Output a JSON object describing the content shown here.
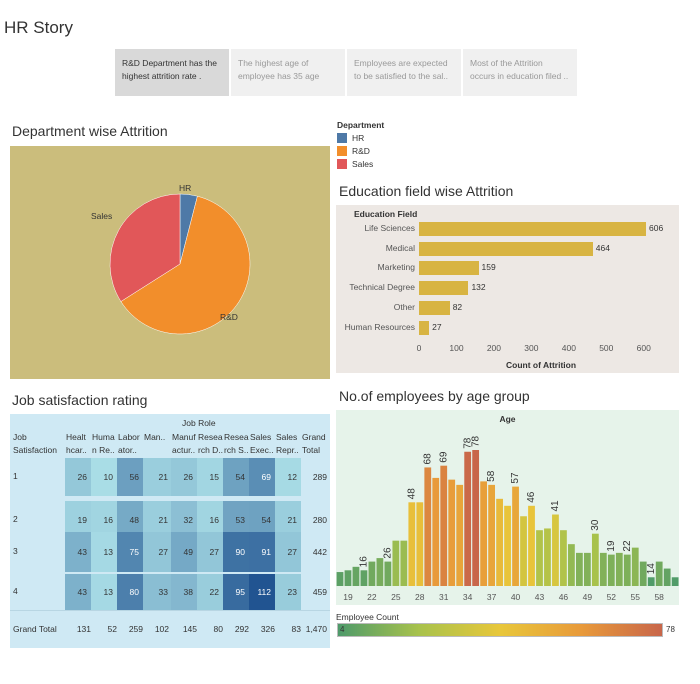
{
  "story": {
    "title": "HR Story",
    "points": [
      "R&D Department has the highest attrition rate .",
      "The highest age of employee has 35 age",
      "Employees are expected to be satisfied to the sal..",
      "Most of the Attrition occurs in education filed .."
    ],
    "active_index": 0
  },
  "sections": {
    "department": "Department wise Attrition",
    "education": "Education field wise Attrition",
    "job": "Job satisfaction rating",
    "age": "No.of employees by age group"
  },
  "legend": {
    "title": "Department",
    "items": [
      {
        "label": "HR",
        "color": "#4e79a7"
      },
      {
        "label": "R&D",
        "color": "#f28e2b"
      },
      {
        "label": "Sales",
        "color": "#e15759"
      }
    ]
  },
  "chart_data": [
    {
      "type": "pie",
      "title": "Department wise Attrition",
      "slices": [
        {
          "label": "HR",
          "value": 4,
          "color": "#4e79a7"
        },
        {
          "label": "R&D",
          "value": 62,
          "color": "#f28e2b"
        },
        {
          "label": "Sales",
          "value": 34,
          "color": "#e15759"
        }
      ]
    },
    {
      "type": "bar",
      "orientation": "horizontal",
      "title": "Education field wise Attrition",
      "category_title": "Education Field",
      "categories": [
        "Life Sciences",
        "Medical",
        "Marketing",
        "Technical Degree",
        "Other",
        "Human Resources"
      ],
      "values": [
        606,
        464,
        159,
        132,
        82,
        27
      ],
      "xlabel": "Count of Attrition",
      "xticks": [
        0,
        100,
        200,
        300,
        400,
        500,
        600
      ],
      "xlim": [
        0,
        700
      ],
      "color": "#d8b442"
    },
    {
      "type": "table",
      "title": "Job satisfaction rating",
      "column_group": "Job Role",
      "row_header": "Job\nSatisfaction",
      "columns": [
        "Healt\nhcar..",
        "Huma\nn Re..",
        "Labor\nator..",
        "Man..",
        "Manuf\nactur..",
        "Resea\nrch D..",
        "Resea\nrch S..",
        "Sales\nExec..",
        "Sales\nRepr..",
        "Grand\nTotal"
      ],
      "rows": [
        {
          "label": "1",
          "values": [
            26,
            10,
            56,
            21,
            26,
            15,
            54,
            69,
            12
          ],
          "total": "289"
        },
        {
          "label": "2",
          "values": [
            19,
            16,
            48,
            21,
            32,
            16,
            53,
            54,
            21
          ],
          "total": "280"
        },
        {
          "label": "3",
          "values": [
            43,
            13,
            75,
            27,
            49,
            27,
            90,
            91,
            27
          ],
          "total": "442"
        },
        {
          "label": "4",
          "values": [
            43,
            13,
            80,
            33,
            38,
            22,
            95,
            112,
            23
          ],
          "total": "459"
        }
      ],
      "grand_total": {
        "label": "Grand Total",
        "values": [
          "131",
          "52",
          "259",
          "102",
          "145",
          "80",
          "292",
          "326",
          "83"
        ],
        "total": "1,470"
      }
    },
    {
      "type": "bar",
      "title": "Age",
      "x": [
        18,
        19,
        20,
        21,
        22,
        23,
        24,
        25,
        26,
        27,
        28,
        29,
        30,
        31,
        32,
        33,
        34,
        35,
        36,
        37,
        38,
        39,
        40,
        41,
        42,
        43,
        44,
        45,
        46,
        47,
        48,
        49,
        50,
        51,
        52,
        53,
        54,
        55,
        56,
        57,
        58,
        59,
        60
      ],
      "values": [
        8,
        9,
        11,
        9,
        14,
        16,
        14,
        26,
        26,
        48,
        48,
        68,
        62,
        69,
        61,
        58,
        77,
        78,
        60,
        58,
        50,
        46,
        57,
        40,
        46,
        32,
        33,
        41,
        32,
        24,
        19,
        19,
        30,
        19,
        18,
        19,
        18,
        22,
        14,
        5,
        14,
        10,
        5
      ],
      "labels": {
        "21": 16,
        "24": 26,
        "27": 48,
        "29": 68,
        "31": 69,
        "34": 78,
        "35": 78,
        "37": 58,
        "40": 57,
        "42": 46,
        "45": 41,
        "50": 30,
        "52": 19,
        "54": 22,
        "57": 14
      },
      "xticks": [
        19,
        22,
        25,
        28,
        31,
        34,
        37,
        40,
        43,
        46,
        49,
        52,
        55,
        58
      ],
      "color_legend": {
        "title": "Employee Count",
        "min": "4",
        "max": "78"
      }
    }
  ]
}
